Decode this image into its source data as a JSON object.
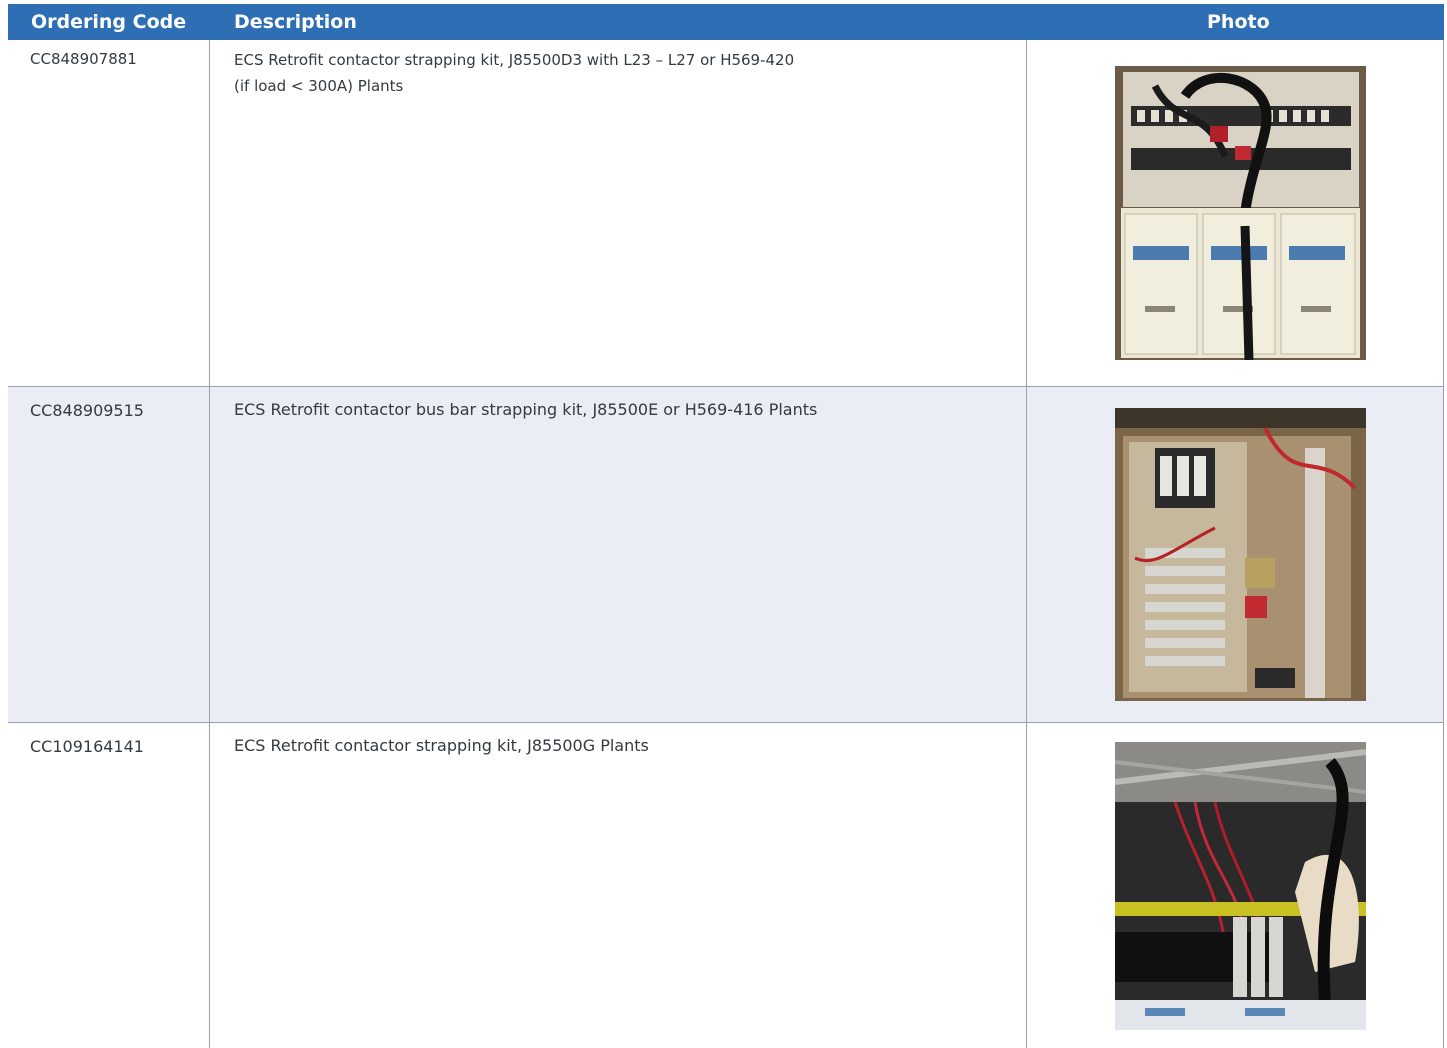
{
  "table": {
    "headers": {
      "ordering_code": "Ordering Code",
      "description": "Description",
      "photo": "Photo"
    },
    "rows": [
      {
        "code": "CC848907881",
        "description_line1": "ECS Retrofit contactor strapping kit, J85500D3 with L23 – L27 or H569-420",
        "description_line2": "(if load < 300A) Plants"
      },
      {
        "code": "CC848909515",
        "description_line1": "ECS Retrofit contactor bus bar strapping kit, J85500E or H569-416 Plants",
        "description_line2": ""
      },
      {
        "code": "CC109164141",
        "description_line1": "ECS Retrofit contactor strapping kit, J85500G Plants",
        "description_line2": ""
      }
    ]
  },
  "colors": {
    "header_bg": "#2e6eb5",
    "header_text": "#ffffff",
    "alt_row_bg": "#eaecf6",
    "grid_line": "#9aa0a8"
  }
}
